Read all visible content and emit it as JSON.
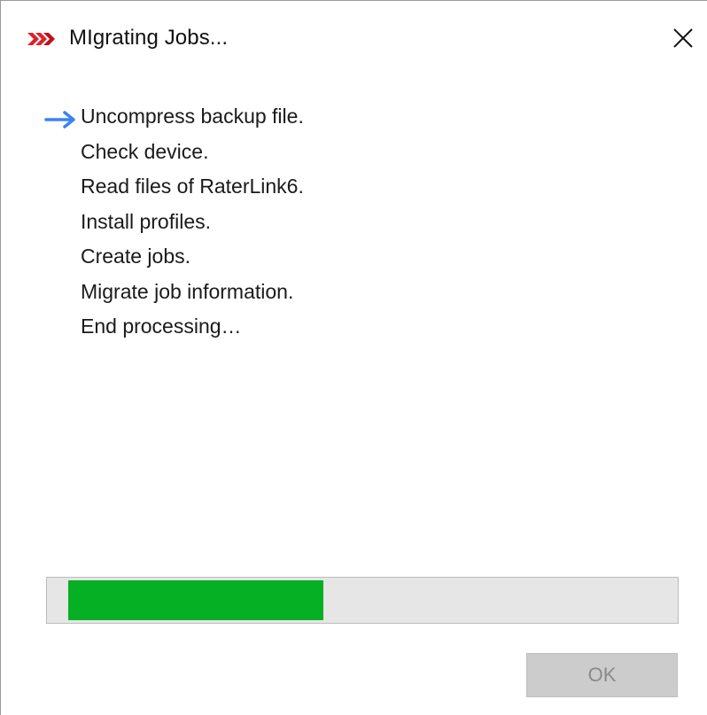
{
  "dialog": {
    "title": "MIgrating Jobs...",
    "app_icon": "red-chevrons-icon",
    "close_icon": "close-icon"
  },
  "steps": [
    {
      "label": "Uncompress backup file.",
      "current": true
    },
    {
      "label": "Check device.",
      "current": false
    },
    {
      "label": "Read files of RaterLink6.",
      "current": false
    },
    {
      "label": "Install profiles.",
      "current": false
    },
    {
      "label": "Create jobs.",
      "current": false
    },
    {
      "label": "Migrate job information.",
      "current": false
    },
    {
      "label": "End processing…",
      "current": false
    }
  ],
  "progress": {
    "value": 0.42,
    "color": "#06b025"
  },
  "buttons": {
    "ok_label": "OK",
    "ok_enabled": false
  },
  "colors": {
    "arrow": "#3b82f6",
    "icon_red": "#e0202a"
  }
}
